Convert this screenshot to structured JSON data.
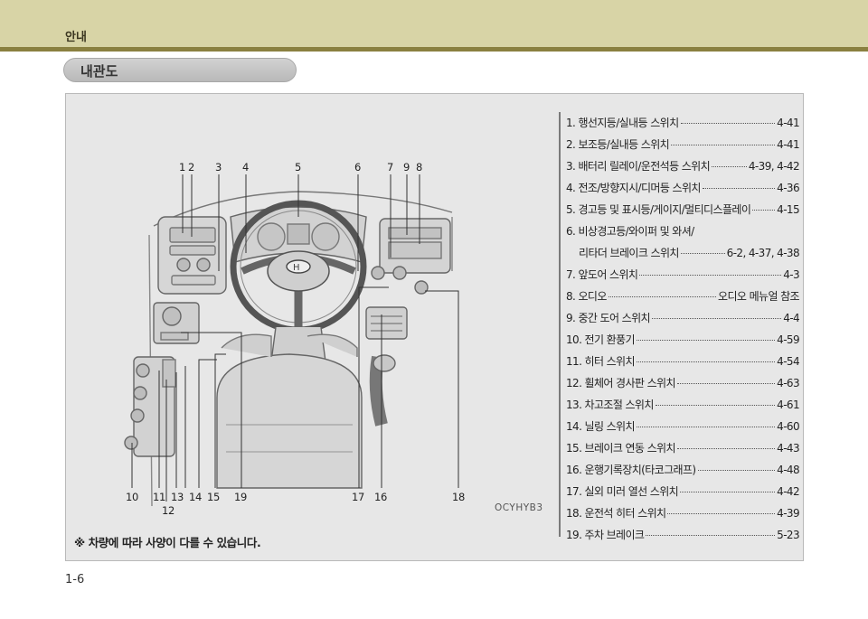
{
  "header": {
    "title": "안내"
  },
  "section": {
    "title": "내관도"
  },
  "figure": {
    "callouts_top": [
      "1",
      "2",
      "3",
      "4",
      "5",
      "6",
      "7",
      "9",
      "8"
    ],
    "callouts_bottom": [
      "10",
      "11",
      "13",
      "14",
      "15",
      "19",
      "17",
      "16",
      "18",
      "12"
    ],
    "image_code": "OCYHYB3",
    "brand_emblem": "hyundai-emblem"
  },
  "footnote": "※ 차량에 따라 사양이 다를 수 있습니다.",
  "index": [
    {
      "text": "1. 행선지등/실내등 스위치",
      "page": "4-41"
    },
    {
      "text": "2. 보조등/실내등 스위치",
      "page": "4-41"
    },
    {
      "text": "3. 배터리 릴레이/운전석등 스위치",
      "page": "4-39, 4-42"
    },
    {
      "text": "4. 전조/방향지시/디머등 스위치",
      "page": "4-36"
    },
    {
      "text": "5. 경고등 및 표시등/게이지/멀티디스플레이",
      "page": "4-15"
    },
    {
      "text": "6. 비상경고등/와이퍼 및 와셔/",
      "page": ""
    },
    {
      "text": "리타더 브레이크 스위치",
      "page": "6-2, 4-37, 4-38"
    },
    {
      "text": "7. 앞도어 스위치",
      "page": "4-3"
    },
    {
      "text": "8. 오디오",
      "page": "오디오 메뉴얼 참조"
    },
    {
      "text": "9. 중간 도어 스위치",
      "page": "4-4"
    },
    {
      "text": "10. 전기 환풍기",
      "page": "4-59"
    },
    {
      "text": "11. 히터 스위치",
      "page": "4-54"
    },
    {
      "text": "12. 휠체어 경사판 스위치",
      "page": "4-63"
    },
    {
      "text": "13. 차고조절 스위치",
      "page": "4-61"
    },
    {
      "text": "14. 닐링 스위치",
      "page": "4-60"
    },
    {
      "text": "15. 브레이크 연동 스위치",
      "page": "4-43"
    },
    {
      "text": "16. 운행기록장치(타코그래프)",
      "page": "4-48"
    },
    {
      "text": "17. 실외 미러 열선 스위치",
      "page": "4-42"
    },
    {
      "text": "18. 운전석 히터 스위치",
      "page": "4-39"
    },
    {
      "text": "19. 주차 브레이크",
      "page": "5-23"
    }
  ],
  "page_number": "1-6"
}
